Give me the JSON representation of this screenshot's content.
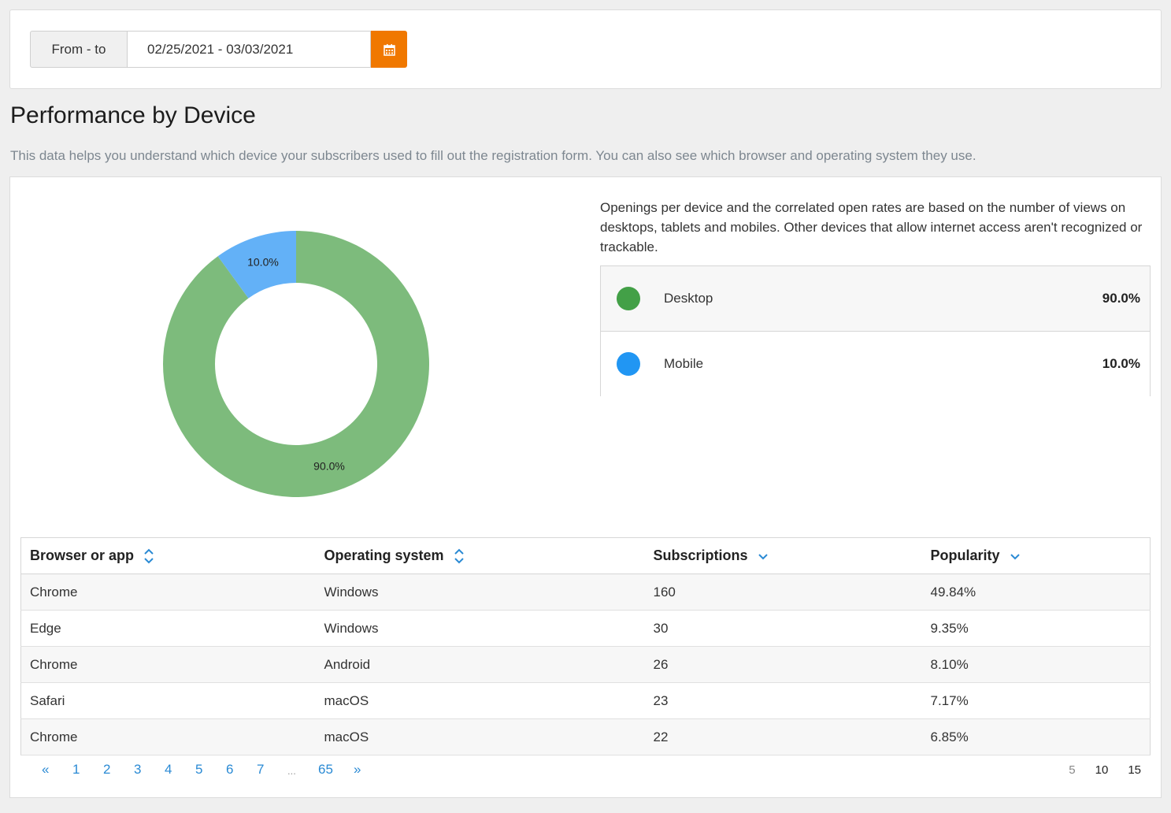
{
  "filter": {
    "from_to_label": "From - to",
    "date_range": "02/25/2021 - 03/03/2021",
    "calendar_icon": "calendar-icon",
    "accent_color": "#f07800"
  },
  "page": {
    "title": "Performance by Device",
    "description": "This data helps you understand which device your subscribers used to fill out the registration form. You can also see which browser and operating system they use."
  },
  "device_info_text": "Openings per device and the correlated open rates are based on the number of views on desktops, tablets and mobiles. Other devices that allow internet access aren't recognized or trackable.",
  "chart_data": {
    "type": "pie",
    "donut": true,
    "categories": [
      "Desktop",
      "Mobile"
    ],
    "values": [
      90.0,
      10.0
    ],
    "labels": [
      "90.0%",
      "10.0%"
    ],
    "colors": [
      "#7dbb7c",
      "#63b1f7"
    ]
  },
  "legend": [
    {
      "name": "Desktop",
      "value": "90.0%",
      "color": "#43a047"
    },
    {
      "name": "Mobile",
      "value": "10.0%",
      "color": "#2196f3"
    }
  ],
  "table": {
    "headers": {
      "browser": "Browser or app",
      "os": "Operating system",
      "subscriptions": "Subscriptions",
      "popularity": "Popularity"
    },
    "rows": [
      {
        "browser": "Chrome",
        "os": "Windows",
        "subscriptions": "160",
        "popularity": "49.84%"
      },
      {
        "browser": "Edge",
        "os": "Windows",
        "subscriptions": "30",
        "popularity": "9.35%"
      },
      {
        "browser": "Chrome",
        "os": "Android",
        "subscriptions": "26",
        "popularity": "8.10%"
      },
      {
        "browser": "Safari",
        "os": "macOS",
        "subscriptions": "23",
        "popularity": "7.17%"
      },
      {
        "browser": "Chrome",
        "os": "macOS",
        "subscriptions": "22",
        "popularity": "6.85%"
      }
    ]
  },
  "pagination": {
    "prev": "«",
    "pages": [
      "1",
      "2",
      "3",
      "4",
      "5",
      "6",
      "7"
    ],
    "ellipsis": "...",
    "last": "65",
    "next": "»",
    "per_page": [
      "5",
      "10",
      "15"
    ]
  }
}
